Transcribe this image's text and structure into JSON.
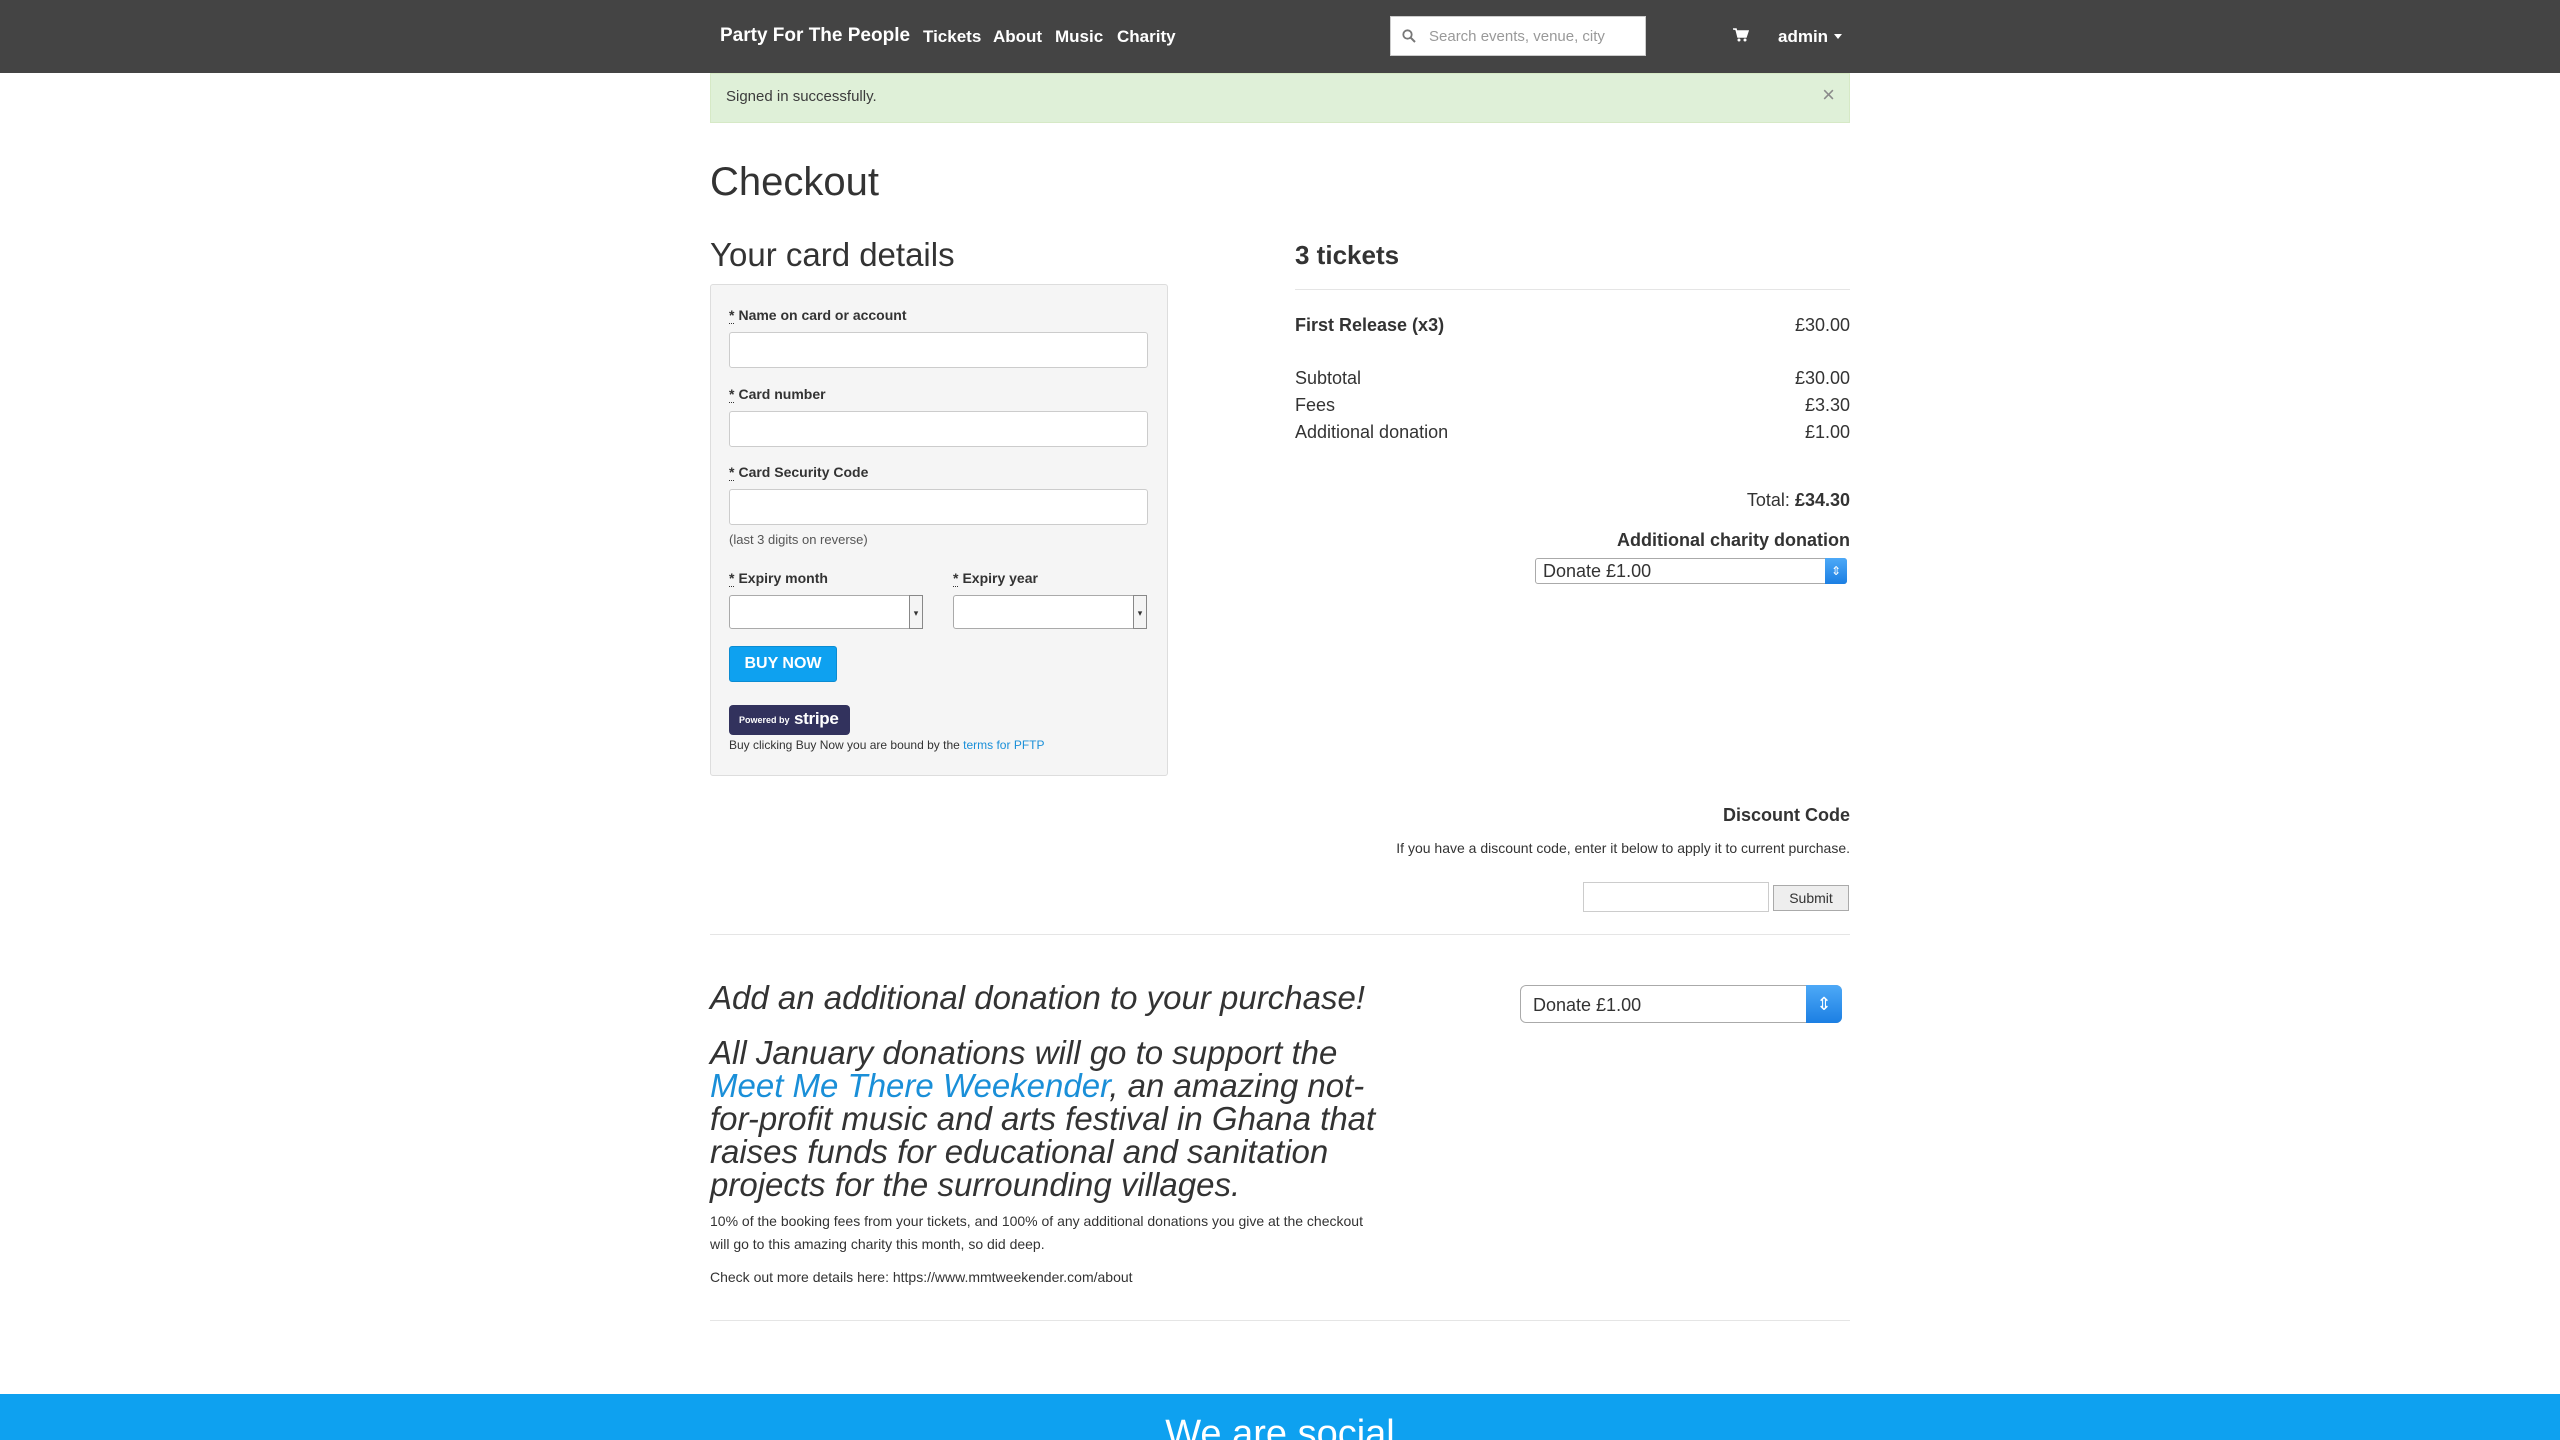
{
  "navbar": {
    "brand": "Party For The People",
    "links": [
      "Tickets",
      "About",
      "Music",
      "Charity"
    ],
    "search_placeholder": "Search events, venue, city",
    "user": "admin"
  },
  "alert": {
    "message": "Signed in successfully.",
    "close": "×"
  },
  "checkout": {
    "title": "Checkout",
    "card_heading": "Your card details",
    "fields": {
      "name_label": "Name on card or account",
      "card_label": "Card number",
      "csc_label": "Card Security Code",
      "csc_hint": "(last 3 digits on reverse)",
      "expiry_month_label": "Expiry month",
      "expiry_year_label": "Expiry year",
      "required_mark": "*"
    },
    "buy_button": "BUY NOW",
    "stripe": {
      "powered_by": "Powered by",
      "brand": "stripe"
    },
    "bound_text": "Buy clicking Buy Now you are bound by the ",
    "terms_link": "terms for PFTP"
  },
  "summary": {
    "tickets_heading": "3 tickets",
    "line_item": {
      "label": "First Release (x3)",
      "amount": "£30.00"
    },
    "subtotal": {
      "label": "Subtotal",
      "amount": "£30.00"
    },
    "fees": {
      "label": "Fees",
      "amount": "£3.30"
    },
    "donation": {
      "label": "Additional donation",
      "amount": "£1.00"
    },
    "total_label": "Total:",
    "total_amount": "£34.30",
    "charity_heading": "Additional charity donation",
    "charity_selected": "Donate £1.00"
  },
  "discount": {
    "heading": "Discount Code",
    "text": "If you have a discount code, enter it below to apply it to current purchase.",
    "submit": "Submit"
  },
  "donation_section": {
    "heading": "Add an additional donation to your purchase!",
    "paragraph_start": "All January donations will go to support the ",
    "link": "Meet Me There Weekender",
    "paragraph_end": ", an amazing not-for-profit music and arts festival in Ghana that raises funds for educational and sanitation projects for the surrounding villages.",
    "fees_note": "10% of the booking fees from your tickets, and 100% of any additional donations you give at the checkout will go to this amazing charity this month, so did deep.",
    "details": "Check out more details here: https://www.mmtweekender.com/about",
    "select_value": "Donate £1.00"
  },
  "footer": {
    "title": "We are social"
  },
  "colors": {
    "navbar": "#444444",
    "accent": "#0ea1f0",
    "alert_bg": "#dff0d8",
    "link": "#1a8fd8"
  },
  "icons": [
    "search-icon",
    "cart-icon",
    "caret-down-icon",
    "close-icon",
    "select-arrows-icon"
  ]
}
